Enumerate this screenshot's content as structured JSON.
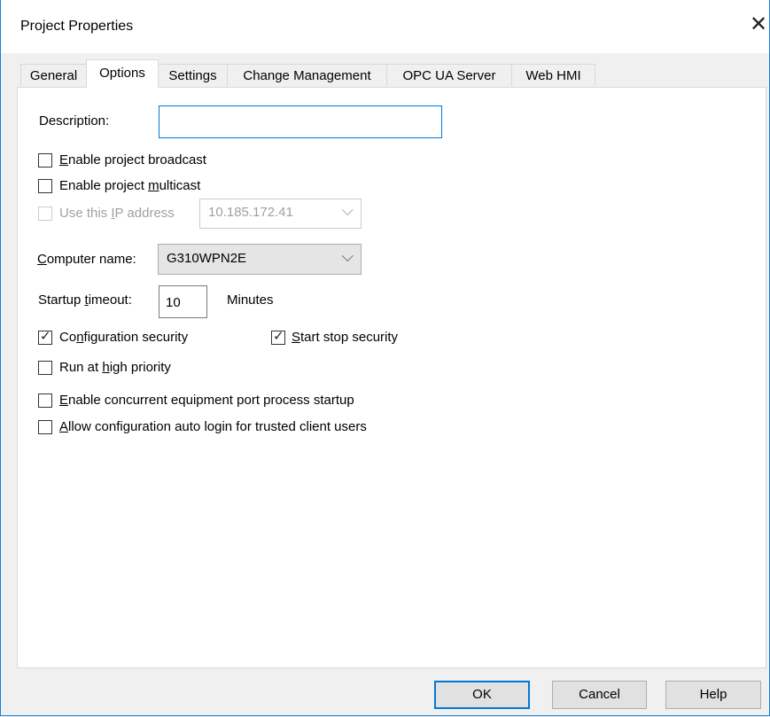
{
  "window": {
    "title": "Project Properties",
    "close_glyph": "✕"
  },
  "tabs": [
    {
      "label": "General"
    },
    {
      "label": "Options"
    },
    {
      "label": "Settings"
    },
    {
      "label": "Change Management"
    },
    {
      "label": "OPC UA Server"
    },
    {
      "label": "Web HMI"
    }
  ],
  "active_tab": "Options",
  "options": {
    "description": {
      "label": "Description:",
      "value": ""
    },
    "enable_broadcast": {
      "pre": "",
      "accel": "E",
      "post": "nable project broadcast",
      "checked": false
    },
    "enable_multicast": {
      "pre": "Enable project ",
      "accel": "m",
      "post": "ulticast",
      "checked": false
    },
    "use_ip": {
      "pre": "Use this ",
      "accel": "I",
      "post": "P address",
      "checked": false,
      "disabled": true,
      "value": "10.185.172.41"
    },
    "computer_name": {
      "accel": "C",
      "post": "omputer name:",
      "value": "G310WPN2E"
    },
    "startup_timeout": {
      "pre": "Startup ",
      "accel": "t",
      "post": "imeout:",
      "value": "10",
      "unit": "Minutes"
    },
    "config_security": {
      "pre": "Co",
      "accel": "n",
      "post": "figuration security",
      "checked": true
    },
    "start_stop_security": {
      "pre": "",
      "accel": "S",
      "post": "tart stop security",
      "checked": true
    },
    "high_priority": {
      "pre": "Run at ",
      "accel": "h",
      "post": "igh priority",
      "checked": false
    },
    "concurrent_startup": {
      "pre": "",
      "accel": "E",
      "post": "nable concurrent equipment port process startup",
      "checked": false
    },
    "auto_login": {
      "pre": "",
      "accel": "A",
      "post": "llow configuration auto login for trusted client users",
      "checked": false
    }
  },
  "buttons": {
    "ok": "OK",
    "cancel": "Cancel",
    "help": "Help"
  },
  "icons": {
    "check": "✓",
    "chevron": "⌵"
  }
}
